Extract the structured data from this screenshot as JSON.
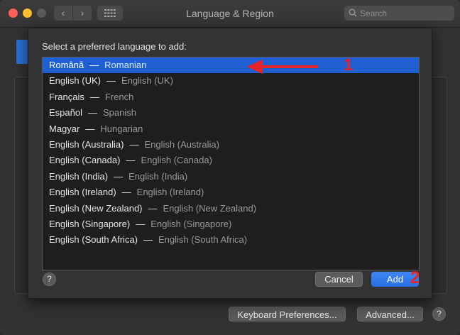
{
  "window": {
    "title": "Language & Region"
  },
  "search": {
    "placeholder": "Search"
  },
  "dialog": {
    "prompt": "Select a preferred language to add:",
    "languages": [
      {
        "native": "Română",
        "english": "Romanian",
        "selected": true
      },
      {
        "native": "English (UK)",
        "english": "English (UK)"
      },
      {
        "native": "Français",
        "english": "French"
      },
      {
        "native": "Español",
        "english": "Spanish"
      },
      {
        "native": "Magyar",
        "english": "Hungarian"
      },
      {
        "native": "English (Australia)",
        "english": "English (Australia)"
      },
      {
        "native": "English (Canada)",
        "english": "English (Canada)"
      },
      {
        "native": "English (India)",
        "english": "English (India)"
      },
      {
        "native": "English (Ireland)",
        "english": "English (Ireland)"
      },
      {
        "native": "English (New Zealand)",
        "english": "English (New Zealand)"
      },
      {
        "native": "English (Singapore)",
        "english": "English (Singapore)"
      },
      {
        "native": "English (South Africa)",
        "english": "English (South Africa)"
      }
    ],
    "separator": "—",
    "help_label": "?",
    "cancel_label": "Cancel",
    "add_label": "Add"
  },
  "footer": {
    "keyboard_label": "Keyboard Preferences...",
    "advanced_label": "Advanced...",
    "help_label": "?"
  },
  "annotations": {
    "step1": "1",
    "step2": "2",
    "color": "#e8242a"
  },
  "colors": {
    "selection": "#1f5fd1",
    "accent": "#2a6fe0"
  }
}
